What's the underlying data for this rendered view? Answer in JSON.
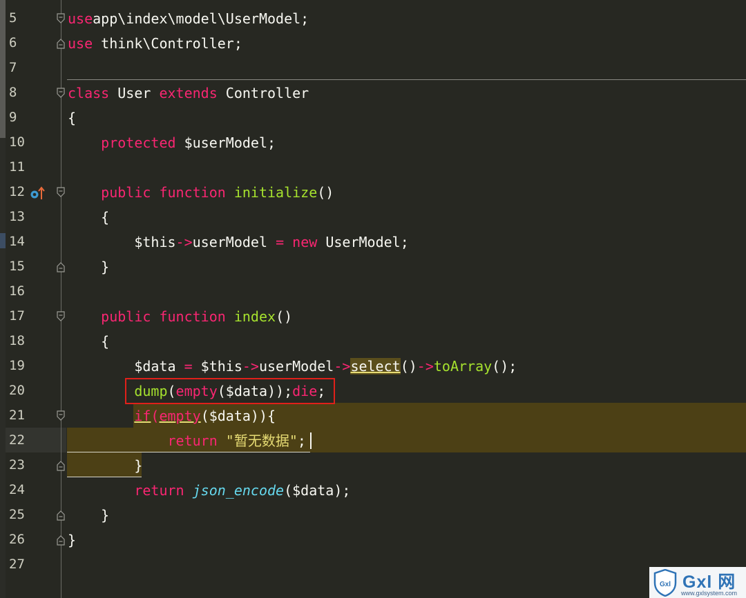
{
  "editor": {
    "lines": [
      {
        "num": "5",
        "tokens": [
          [
            "kw",
            "use"
          ],
          [
            "",
            "app\\index\\model\\UserModel;"
          ]
        ]
      },
      {
        "num": "6",
        "tokens": [
          [
            "kw",
            "use"
          ],
          [
            "",
            " think\\Controller;"
          ]
        ]
      },
      {
        "num": "7",
        "tokens": []
      },
      {
        "num": "8",
        "tokens": [
          [
            "kw",
            "class"
          ],
          [
            "",
            " User "
          ],
          [
            "kw",
            "extends"
          ],
          [
            "",
            " Controller"
          ]
        ]
      },
      {
        "num": "9",
        "tokens": [
          [
            "",
            "{"
          ]
        ]
      },
      {
        "num": "10",
        "tokens": [
          [
            "",
            "    "
          ],
          [
            "kw",
            "protected"
          ],
          [
            "",
            " $userModel;"
          ]
        ]
      },
      {
        "num": "11",
        "tokens": []
      },
      {
        "num": "12",
        "tokens": [
          [
            "",
            "    "
          ],
          [
            "kw",
            "public"
          ],
          [
            "",
            " "
          ],
          [
            "kw",
            "function"
          ],
          [
            "",
            " "
          ],
          [
            "fn",
            "initialize"
          ],
          [
            "",
            "()"
          ]
        ]
      },
      {
        "num": "13",
        "tokens": [
          [
            "",
            "    {"
          ]
        ]
      },
      {
        "num": "14",
        "tokens": [
          [
            "",
            "        $this"
          ],
          [
            "kw",
            "->"
          ],
          [
            "",
            "userModel "
          ],
          [
            "kw",
            "="
          ],
          [
            "",
            " "
          ],
          [
            "kw",
            "new"
          ],
          [
            "",
            " UserModel;"
          ]
        ]
      },
      {
        "num": "15",
        "tokens": [
          [
            "",
            "    }"
          ]
        ]
      },
      {
        "num": "16",
        "tokens": []
      },
      {
        "num": "17",
        "tokens": [
          [
            "",
            "    "
          ],
          [
            "kw",
            "public"
          ],
          [
            "",
            " "
          ],
          [
            "kw",
            "function"
          ],
          [
            "",
            " "
          ],
          [
            "fn",
            "index"
          ],
          [
            "",
            "()"
          ]
        ]
      },
      {
        "num": "18",
        "tokens": [
          [
            "",
            "    {"
          ]
        ]
      },
      {
        "num": "19",
        "tokens": [
          [
            "",
            "        $data "
          ],
          [
            "kw",
            "="
          ],
          [
            "",
            " $this"
          ],
          [
            "kw",
            "->"
          ],
          [
            "",
            "userModel"
          ],
          [
            "kw",
            "->"
          ],
          [
            "ul sel",
            "select"
          ],
          [
            "",
            "()"
          ],
          [
            "kw",
            "->"
          ],
          [
            "fn",
            "toArray"
          ],
          [
            "",
            "();"
          ]
        ]
      },
      {
        "num": "20",
        "tokens": [
          [
            "",
            "        "
          ],
          [
            "fn",
            "dump"
          ],
          [
            "",
            "("
          ],
          [
            "kw",
            "empty"
          ],
          [
            "",
            "($data));"
          ],
          [
            "kw",
            "die"
          ],
          [
            "",
            ";"
          ]
        ]
      },
      {
        "num": "21",
        "tokens": [
          [
            "",
            "        "
          ],
          [
            "kw ul",
            "if"
          ],
          [
            "kw",
            "("
          ],
          [
            "kw ul",
            "empty"
          ],
          [
            "",
            "($data)){"
          ]
        ]
      },
      {
        "num": "22",
        "tokens": [
          [
            "",
            "            "
          ],
          [
            "kw",
            "return"
          ],
          [
            "",
            " "
          ],
          [
            "st",
            "\"暂无数据\""
          ],
          [
            "",
            ";"
          ]
        ]
      },
      {
        "num": "23",
        "tokens": [
          [
            "",
            "        }"
          ]
        ]
      },
      {
        "num": "24",
        "tokens": [
          [
            "",
            "        "
          ],
          [
            "kw",
            "return"
          ],
          [
            "",
            " "
          ],
          [
            "it",
            "json_encode"
          ],
          [
            "",
            "($data);"
          ]
        ]
      },
      {
        "num": "25",
        "tokens": [
          [
            "",
            "    }"
          ]
        ]
      },
      {
        "num": "26",
        "tokens": [
          [
            "",
            "}"
          ]
        ]
      },
      {
        "num": "27",
        "tokens": []
      }
    ],
    "folds": {
      "5": "start",
      "6": "end",
      "8": "start",
      "12": "start",
      "15": "end",
      "17": "start",
      "21": "start",
      "23": "end",
      "25": "end",
      "26": "end"
    },
    "colors": {
      "background": "#272822",
      "keyword": "#f92672",
      "function": "#a6e22e",
      "italic_function": "#66d9ef",
      "string": "#e6db74",
      "highlight_block": "#4c4015",
      "red_box": "#e0201a"
    },
    "gutter_icon": "override-method-icon"
  },
  "watermark": {
    "title": "Gxl 网",
    "url": "www.gxlsystem.com",
    "icon": "shield-icon",
    "shield_text": "Gxl"
  }
}
